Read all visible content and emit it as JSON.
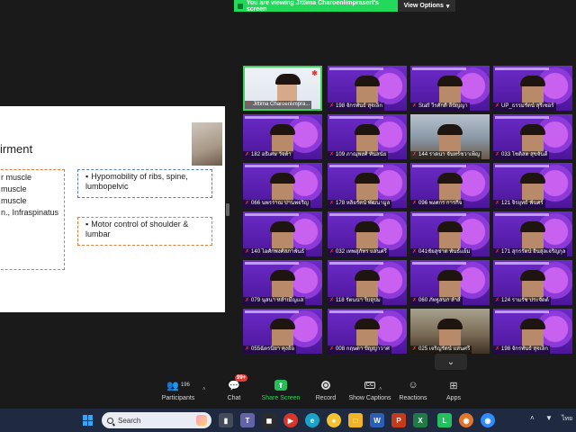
{
  "banner": {
    "message": "You are viewing Jittima Charoenlimprasert's screen",
    "view_options": "View Options"
  },
  "slide": {
    "title": "irment",
    "left_items": [
      "r muscle",
      "muscle",
      "muscle",
      "n., Infraspinatus"
    ],
    "right_box_1": "Hypomobility of ribs, spine, lumbopelvic",
    "right_box_2": "Motor control of shoulder & lumbar"
  },
  "tiles": [
    {
      "name": "Jittima Charoenlimpra...",
      "type": "self"
    },
    {
      "name": "198 จักรพันธ์ สุจเล็ก",
      "type": "purple"
    },
    {
      "name": "Staff วีรศักดิ์ ลีปัญญา",
      "type": "purple"
    },
    {
      "name": "UP_ธรรมรัตน์ สุริเซอร์",
      "type": "purple"
    },
    {
      "name": "182 อธิเศษ วัจต์า",
      "type": "purple"
    },
    {
      "name": "109 ภาณุพงศ์ ทั้นสนัย",
      "type": "purple"
    },
    {
      "name": "144 ราดนา จันทร์ชวาเพ็ญ",
      "type": "room"
    },
    {
      "name": "033 โชติสต สุขจันดี",
      "type": "purple"
    },
    {
      "name": "066 นพรราณ ปานพจริญ",
      "type": "purple"
    },
    {
      "name": "178 หลิยรัตน์ พัฒนามูล",
      "type": "purple"
    },
    {
      "name": "096 พงศกร การกิจ",
      "type": "purple"
    },
    {
      "name": "121 จิรยุทธ์ ฟันศร์",
      "type": "purple"
    },
    {
      "name": "140 ไอศักพงศ์สภาพันธ์",
      "type": "purple"
    },
    {
      "name": "032 เทพสุภัทร แสนศรี",
      "type": "purple"
    },
    {
      "name": "041ชัยสุชาด พันธ์แย้ม",
      "type": "purple"
    },
    {
      "name": "171 สุกรรัตน์ อินสุลเจริญกุล",
      "type": "purple"
    },
    {
      "name": "079 นุสนา หลำเมีญแล",
      "type": "purple"
    },
    {
      "name": "118 รัตนนา ใบอุปม",
      "type": "purple"
    },
    {
      "name": "060 ภัทฐสนก ลำส์",
      "type": "purple"
    },
    {
      "name": "124 รามรัช ประจัดต์",
      "type": "purple"
    },
    {
      "name": "055ฉัตรนิยา คุงอ้อ",
      "type": "purple"
    },
    {
      "name": "008 กฤษดา ปัญญาวาศ",
      "type": "purple"
    },
    {
      "name": "025 เจริญรัตน์ แสนศรี",
      "type": "room2"
    },
    {
      "name": "198 จักรพันธ์ สุจเล็ก",
      "type": "purple"
    }
  ],
  "toolbar": {
    "participants": {
      "label": "Participants",
      "count": "196"
    },
    "chat": {
      "label": "Chat",
      "badge": "99+"
    },
    "share": {
      "label": "Share Screen"
    },
    "record": {
      "label": "Record"
    },
    "captions": {
      "label": "Show Captions",
      "icon_text": "CC"
    },
    "reactions": {
      "label": "Reactions"
    },
    "apps": {
      "label": "Apps"
    }
  },
  "taskbar": {
    "search_placeholder": "Search",
    "lang": "ไทย"
  }
}
